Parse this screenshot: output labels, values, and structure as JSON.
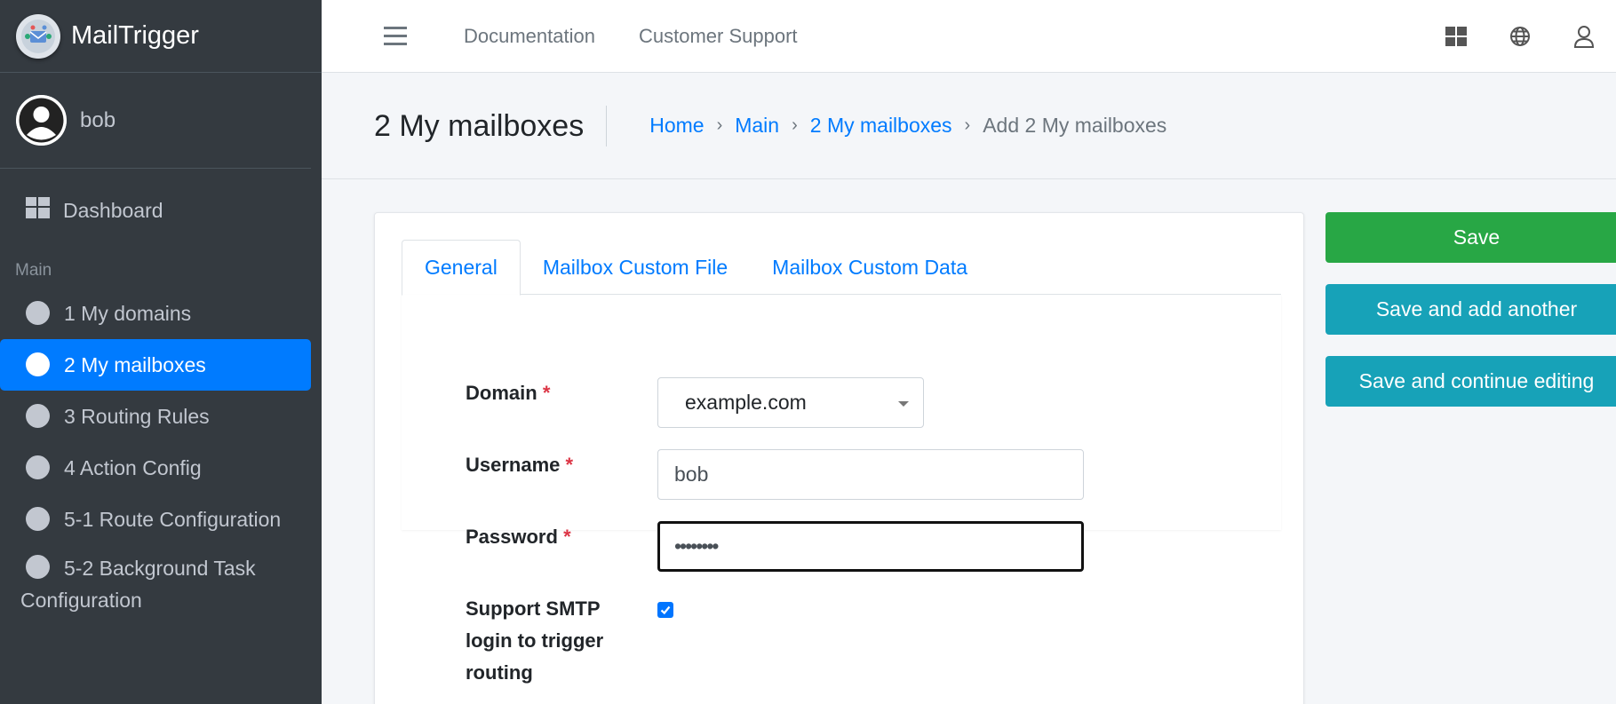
{
  "brand": {
    "name": "MailTrigger"
  },
  "user": {
    "name": "bob"
  },
  "sidebar": {
    "dashboard": "Dashboard",
    "section_header": "Main",
    "items": [
      {
        "label": "1 My domains",
        "active": false
      },
      {
        "label": "2 My mailboxes",
        "active": true
      },
      {
        "label": "3 Routing Rules",
        "active": false
      },
      {
        "label": "4 Action Config",
        "active": false
      },
      {
        "label": "5-1 Route Configuration",
        "active": false
      },
      {
        "label_line1": "5-2 Background Task",
        "label_line2": "Configuration",
        "active": false
      }
    ]
  },
  "topbar": {
    "links": [
      "Documentation",
      "Customer Support"
    ],
    "icons": [
      "apps-icon",
      "globe-icon",
      "user-icon"
    ]
  },
  "header": {
    "title": "2 My mailboxes",
    "breadcrumb": [
      "Home",
      "Main",
      "2 My mailboxes",
      "Add 2 My mailboxes"
    ],
    "separator": "›"
  },
  "tabs": [
    "General",
    "Mailbox Custom File",
    "Mailbox Custom Data"
  ],
  "form": {
    "domain": {
      "label": "Domain",
      "required": "*",
      "value": "example.com"
    },
    "username": {
      "label": "Username",
      "required": "*",
      "value": "bob"
    },
    "password": {
      "label": "Password",
      "required": "*",
      "value": "••••••••"
    },
    "smtp": {
      "label_lines": [
        "Support SMTP",
        "login to trigger",
        "routing"
      ],
      "checked": true
    }
  },
  "actions": {
    "save": "Save",
    "save_add": "Save and add another",
    "save_continue": "Save and continue editing"
  },
  "colors": {
    "sidebar_bg": "#343a40",
    "active": "#007bff",
    "save": "#28a745",
    "info": "#17a2b8",
    "required": "#dc3545"
  }
}
